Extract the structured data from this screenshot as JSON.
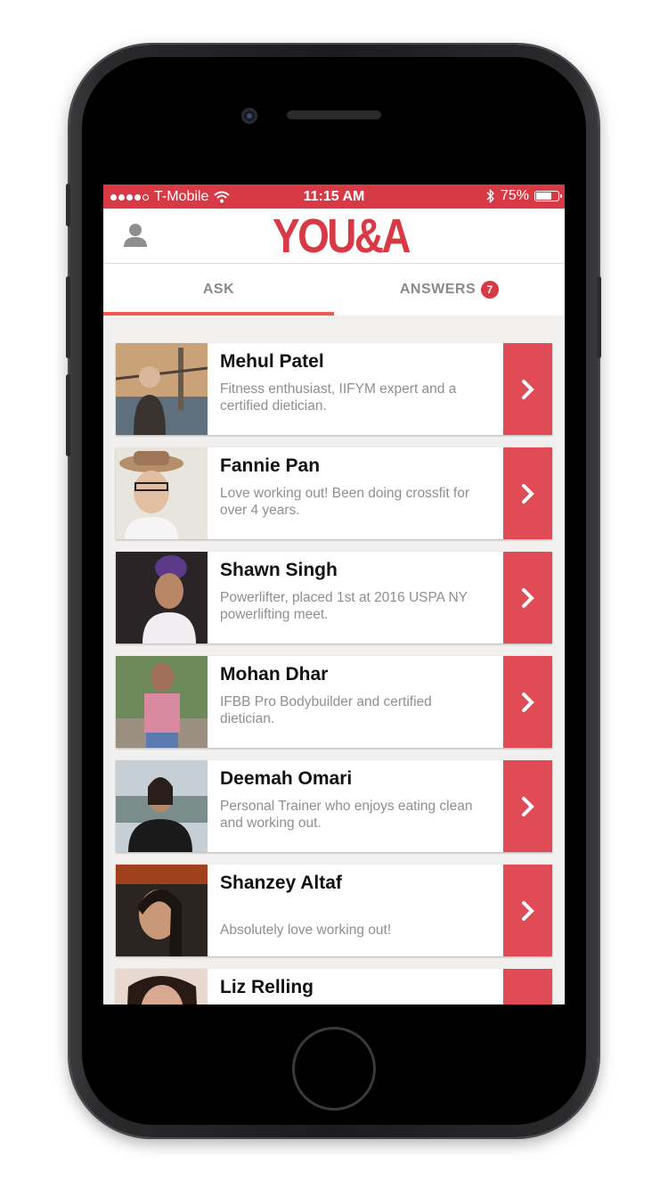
{
  "status_bar": {
    "carrier": "T-Mobile",
    "time": "11:15 AM",
    "battery": "75%",
    "battery_level": 0.75
  },
  "header": {
    "logo": "YOU&A"
  },
  "tabs": [
    {
      "label": "ASK",
      "active": true
    },
    {
      "label": "ANSWERS",
      "badge": "7"
    }
  ],
  "experts": [
    {
      "name": "Mehul Patel",
      "description": "Fitness enthusiast, IIFYM expert and a certified dietician."
    },
    {
      "name": "Fannie Pan",
      "description": "Love working out! Been doing crossfit for over 4 years."
    },
    {
      "name": "Shawn Singh",
      "description": "Powerlifter, placed 1st at 2016 USPA NY powerlifting meet."
    },
    {
      "name": "Mohan Dhar",
      "description": "IFBB Pro Bodybuilder and certified dietician."
    },
    {
      "name": "Deemah Omari",
      "description": "Personal Trainer who enjoys eating clean and working out."
    },
    {
      "name": "Shanzey Altaf",
      "description": "Absolutely love working out!"
    },
    {
      "name": "Liz Relling",
      "description": ""
    }
  ],
  "colors": {
    "brand_red": "#d83a45",
    "tab_underline": "#ef5a4c",
    "arrow_bg": "#e14b56"
  }
}
